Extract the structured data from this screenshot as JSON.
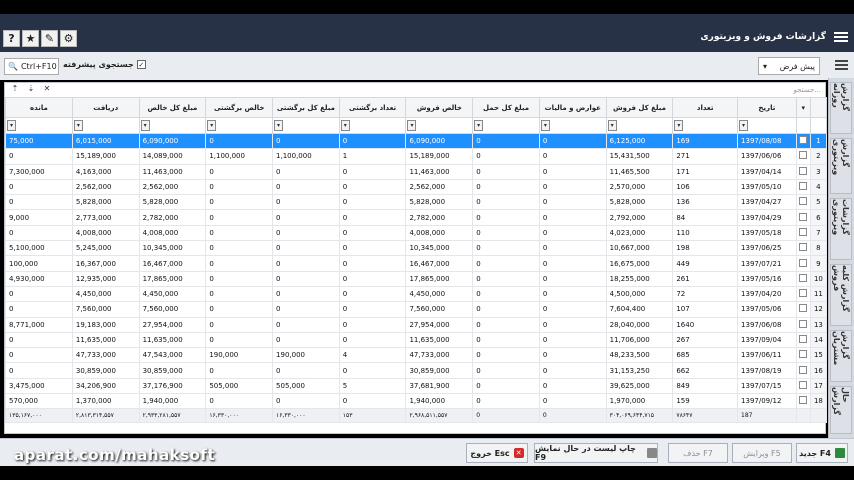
{
  "toolbar": {
    "icons": [
      "help-icon",
      "star-icon",
      "tools-icon",
      "gear-icon"
    ],
    "help_label": "?"
  },
  "window": {
    "title": "گزارشات فروش و ویزیتوری"
  },
  "search": {
    "shortcut_label": "Ctrl+F10",
    "advanced_label": "جستجوی پیشرفته",
    "filter_combo_value": "پیش فرض",
    "grid_search_placeholder": "جستجو..."
  },
  "columns": [
    "تاریخ",
    "تعداد",
    "مبلغ کل فروش",
    "عوارض و مالیات",
    "مبلغ کل حمل",
    "خالص فروش",
    "تعداد برگشتی",
    "مبلغ کل برگشتی",
    "خالص برگشتی",
    "مبلغ کل خالص",
    "دریافت",
    "مانده"
  ],
  "rows": [
    [
      "1397/08/08",
      "169",
      "6,125,000",
      "0",
      "0",
      "6,090,000",
      "0",
      "0",
      "0",
      "6,090,000",
      "6,015,000",
      "75,000"
    ],
    [
      "1397/06/06",
      "271",
      "15,431,500",
      "0",
      "0",
      "15,189,000",
      "1",
      "1,100,000",
      "1,100,000",
      "14,089,000",
      "15,189,000",
      "0"
    ],
    [
      "1397/04/14",
      "171",
      "11,465,500",
      "0",
      "0",
      "11,463,000",
      "0",
      "0",
      "0",
      "11,463,000",
      "4,163,000",
      "7,300,000"
    ],
    [
      "1397/05/10",
      "106",
      "2,570,000",
      "0",
      "0",
      "2,562,000",
      "0",
      "0",
      "0",
      "2,562,000",
      "2,562,000",
      "0"
    ],
    [
      "1397/04/27",
      "136",
      "5,828,000",
      "0",
      "0",
      "5,828,000",
      "0",
      "0",
      "0",
      "5,828,000",
      "5,828,000",
      "0"
    ],
    [
      "1397/04/29",
      "84",
      "2,792,000",
      "0",
      "0",
      "2,782,000",
      "0",
      "0",
      "0",
      "2,782,000",
      "2,773,000",
      "9,000"
    ],
    [
      "1397/05/18",
      "110",
      "4,023,000",
      "0",
      "0",
      "4,008,000",
      "0",
      "0",
      "0",
      "4,008,000",
      "4,008,000",
      "0"
    ],
    [
      "1397/06/25",
      "198",
      "10,667,000",
      "0",
      "0",
      "10,345,000",
      "0",
      "0",
      "0",
      "10,345,000",
      "5,245,000",
      "5,100,000"
    ],
    [
      "1397/07/21",
      "449",
      "16,675,000",
      "0",
      "0",
      "16,467,000",
      "0",
      "0",
      "0",
      "16,467,000",
      "16,367,000",
      "100,000"
    ],
    [
      "1397/05/16",
      "261",
      "18,255,000",
      "0",
      "0",
      "17,865,000",
      "0",
      "0",
      "0",
      "17,865,000",
      "12,935,000",
      "4,930,000"
    ],
    [
      "1397/04/20",
      "72",
      "4,500,000",
      "0",
      "0",
      "4,450,000",
      "0",
      "0",
      "0",
      "4,450,000",
      "4,450,000",
      "0"
    ],
    [
      "1397/05/06",
      "107",
      "7,604,400",
      "0",
      "0",
      "7,560,000",
      "0",
      "0",
      "0",
      "7,560,000",
      "7,560,000",
      "0"
    ],
    [
      "1397/06/08",
      "1640",
      "28,040,000",
      "0",
      "0",
      "27,954,000",
      "0",
      "0",
      "0",
      "27,954,000",
      "19,183,000",
      "8,771,000"
    ],
    [
      "1397/09/04",
      "267",
      "11,706,000",
      "0",
      "0",
      "11,635,000",
      "0",
      "0",
      "0",
      "11,635,000",
      "11,635,000",
      "0"
    ],
    [
      "1397/06/11",
      "685",
      "48,233,500",
      "0",
      "0",
      "47,733,000",
      "4",
      "190,000",
      "190,000",
      "47,543,000",
      "47,733,000",
      "0"
    ],
    [
      "1397/08/19",
      "662",
      "31,153,250",
      "0",
      "0",
      "30,859,000",
      "0",
      "0",
      "0",
      "30,859,000",
      "30,859,000",
      "0"
    ],
    [
      "1397/07/15",
      "849",
      "39,625,000",
      "0",
      "0",
      "37,681,900",
      "5",
      "505,000",
      "505,000",
      "37,176,900",
      "34,206,900",
      "3,475,000"
    ],
    [
      "1397/09/12",
      "159",
      "1,970,000",
      "0",
      "0",
      "1,940,000",
      "0",
      "0",
      "0",
      "1,940,000",
      "1,370,000",
      "570,000"
    ]
  ],
  "row_numbers": [
    "1",
    "2",
    "3",
    "4",
    "5",
    "6",
    "7",
    "8",
    "9",
    "10",
    "11",
    "12",
    "13",
    "14",
    "15",
    "16",
    "17",
    "18"
  ],
  "totals": [
    "187",
    "۷۸۶۴۷",
    "۳۰۴,۰۶۹,۶۴۴,۷۱۵",
    "0",
    "0",
    "۲,۹۶۸,۵۱۱,۵۵۷",
    "۱۵۳",
    "۱۶,۳۳۰,۰۰۰",
    "۱۶,۳۳۰,۰۰۰",
    "۲,۹۳۳,۲۸۱,۵۵۷",
    "۲,۸۱۳,۳۱۴,۵۵۷",
    "۱۳۵,۱۶۷,۰۰۰"
  ],
  "side_tabs": [
    "گزارش روزانه",
    "گزارش ویزیتوری",
    "گزارشات ویزیتوری",
    "گزارش کلیه فروش",
    "گزارش مشتریان",
    "حال گزارش"
  ],
  "buttons": {
    "new": "جدید F4",
    "edit": "ویرایش F5",
    "delete": "حذف F7",
    "print": "چاپ لیست در حال نمایش F9",
    "exit": "خروج Esc"
  },
  "watermark": "aparat.com/mahaksoft",
  "colors": {
    "selected_row": "#1e90ff",
    "title_bar": "#283246"
  }
}
